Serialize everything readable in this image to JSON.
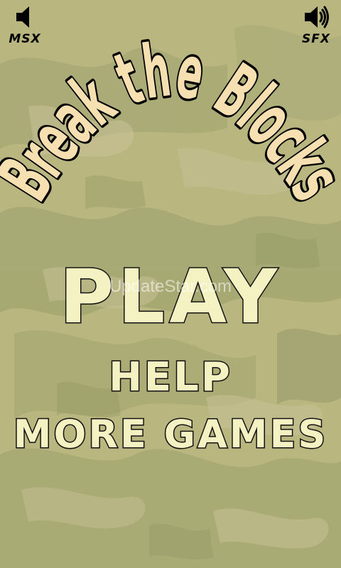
{
  "title": "Break the Blocks",
  "music_toggle": {
    "label": "MSX",
    "icon": "speaker-muted-icon"
  },
  "sfx_toggle": {
    "label": "SFX",
    "icon": "speaker-sound-icon"
  },
  "menu": {
    "play": "PLAY",
    "help": "HELP",
    "more_games": "MORE GAMES"
  },
  "watermark": "UpdateStar.com",
  "colors": {
    "background": "#b9b680",
    "title_fill": "#f6dfb0",
    "menu_fill": "#f4f2c2",
    "outline": "#000000"
  }
}
